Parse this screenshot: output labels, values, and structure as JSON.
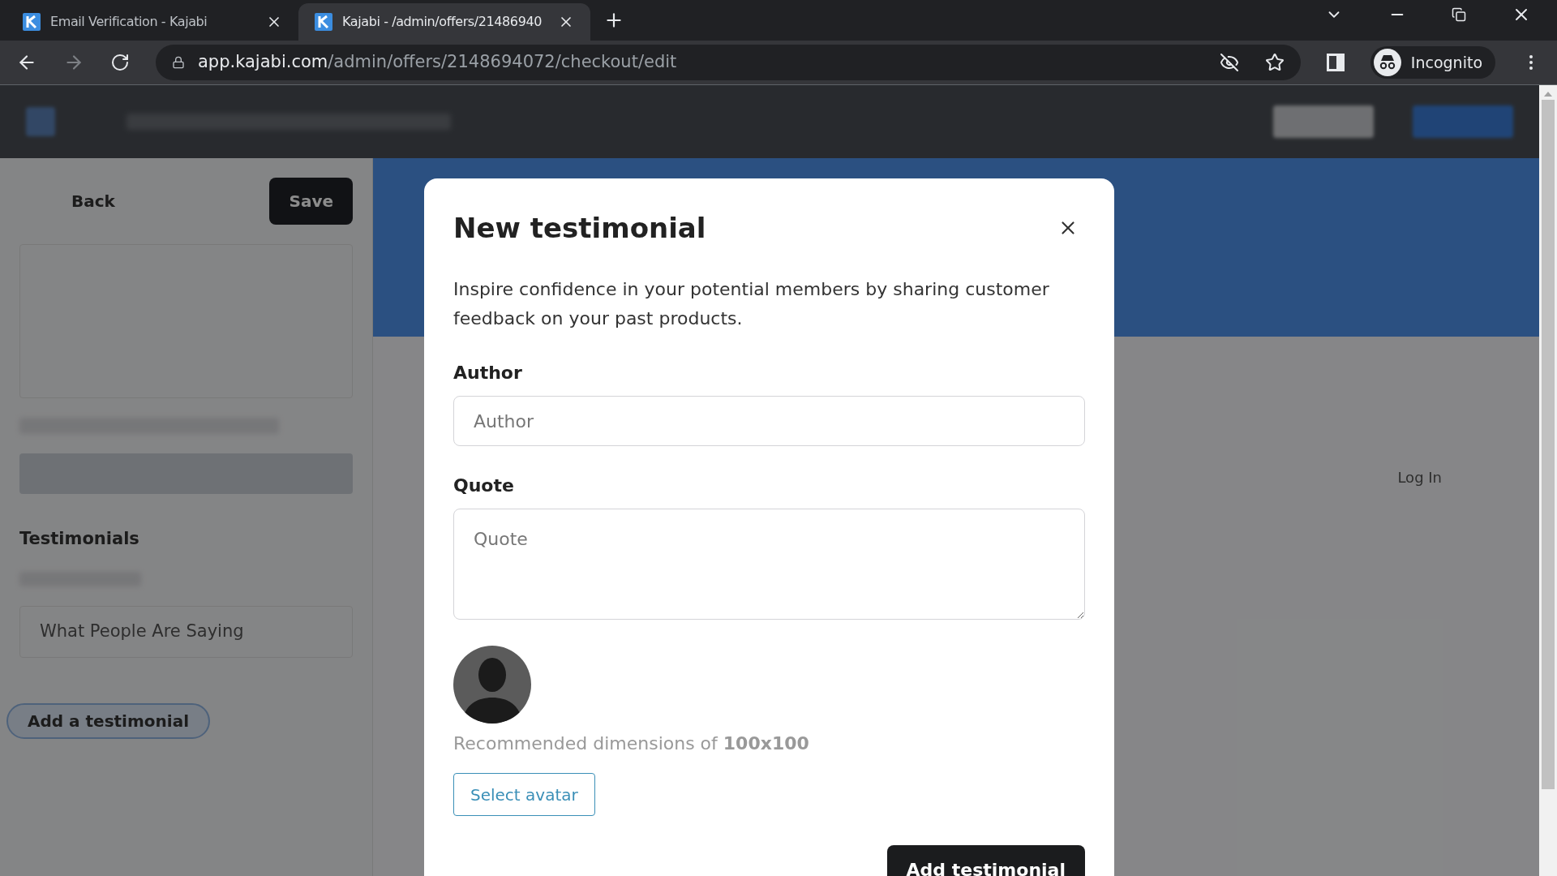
{
  "browser": {
    "tabs": [
      {
        "title": "Email Verification - Kajabi",
        "selected": false
      },
      {
        "title": "Kajabi - /admin/offers/21486940",
        "selected": true
      }
    ],
    "url": {
      "host": "app.kajabi.com",
      "path": "/admin/offers/2148694072/checkout/edit"
    },
    "profile": "Incognito"
  },
  "background": {
    "back": "Back",
    "save": "Save",
    "section_title": "Testimonials",
    "testimonial": "What People Are Saying",
    "add_button": "Add a testimonial",
    "login": "Log In"
  },
  "modal": {
    "title": "New testimonial",
    "description": "Inspire confidence in your potential members by sharing customer feedback on your past products.",
    "fields": [
      {
        "kind": "input",
        "label": "Author",
        "placeholder": "Author"
      },
      {
        "kind": "textarea",
        "label": "Quote",
        "placeholder": "Quote"
      }
    ],
    "avatar_hint": "Recommended dimensions of **100x100**",
    "select_button": "Select avatar",
    "submit_button": "Add testimonial"
  }
}
